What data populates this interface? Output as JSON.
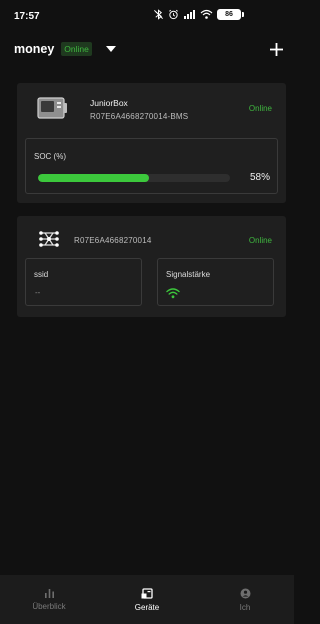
{
  "statusbar": {
    "time": "17:57",
    "battery": "86"
  },
  "header": {
    "title": "money",
    "status": "Online"
  },
  "devices": [
    {
      "name": "JuniorBox",
      "id": "R07E6A4668270014-BMS",
      "status": "Online",
      "icon": "battery-box-icon",
      "soc": {
        "label": "SOC (%)",
        "percent": 58,
        "value_text": "58%"
      }
    },
    {
      "id": "R07E6A4668270014",
      "status": "Online",
      "icon": "network-hub-icon",
      "ssid_label": "ssid",
      "ssid_value": "--",
      "signal_label": "Signalstärke",
      "signal_icon": "wifi-icon"
    }
  ],
  "colors": {
    "accent_green": "#3cc83c",
    "background": "#111111",
    "card": "#1f1f1f"
  },
  "bottomnav": {
    "items": [
      {
        "label": "Überblick",
        "icon": "chart-icon",
        "active": false
      },
      {
        "label": "Geräte",
        "icon": "devices-icon",
        "active": true
      },
      {
        "label": "Ich",
        "icon": "profile-icon",
        "active": false
      }
    ]
  }
}
